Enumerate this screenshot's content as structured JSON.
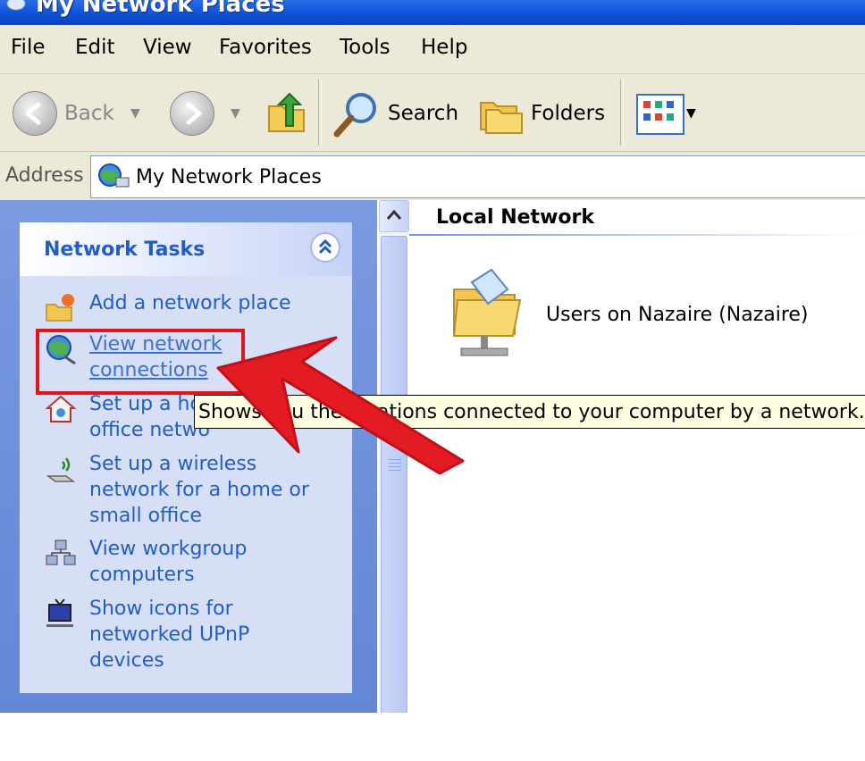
{
  "window": {
    "title": "My Network Places",
    "title_color": "#0b4fd6"
  },
  "menu": [
    "File",
    "Edit",
    "View",
    "Favorites",
    "Tools",
    "Help"
  ],
  "toolbar": {
    "back_label": "Back",
    "search_label": "Search",
    "folders_label": "Folders",
    "icons": [
      "back-arrow-icon",
      "forward-arrow-icon",
      "up-folder-icon",
      "magnifier-icon",
      "folders-icon",
      "views-icon"
    ]
  },
  "address": {
    "label": "Address",
    "value": "My Network Places"
  },
  "tasks": {
    "heading": "Network Tasks",
    "items": [
      {
        "label": "Add a network place",
        "icon": "add-network-place-icon"
      },
      {
        "label": "View network connections",
        "icon": "network-connections-icon"
      },
      {
        "label": "Set up a home or small office network",
        "icon": "home-network-icon"
      },
      {
        "label": "Set up a wireless network for a home or small office",
        "icon": "wireless-icon"
      },
      {
        "label": "View workgroup computers",
        "icon": "workgroup-icon"
      },
      {
        "label": "Show icons for networked UPnP devices",
        "icon": "upnp-icon"
      }
    ],
    "visible_lines": {
      "t0": [
        "Add a network place"
      ],
      "t1": [
        "View network",
        "connections"
      ],
      "t2": [
        "Set up a ho",
        "office netwo"
      ],
      "t3": [
        "Set up a wireless",
        "network for a home or",
        "small office"
      ],
      "t4": [
        "View workgroup",
        "computers"
      ],
      "t5": [
        "Show icons for",
        "networked UPnP",
        "devices"
      ]
    }
  },
  "content": {
    "group_heading": "Local Network",
    "item_label": "Users on Nazaire (Nazaire)"
  },
  "tooltip": {
    "text": "Shows you the locations connected to your computer by a network."
  },
  "annotation": {
    "highlight_color": "#e0151a",
    "arrow_color": "#e31b23"
  }
}
